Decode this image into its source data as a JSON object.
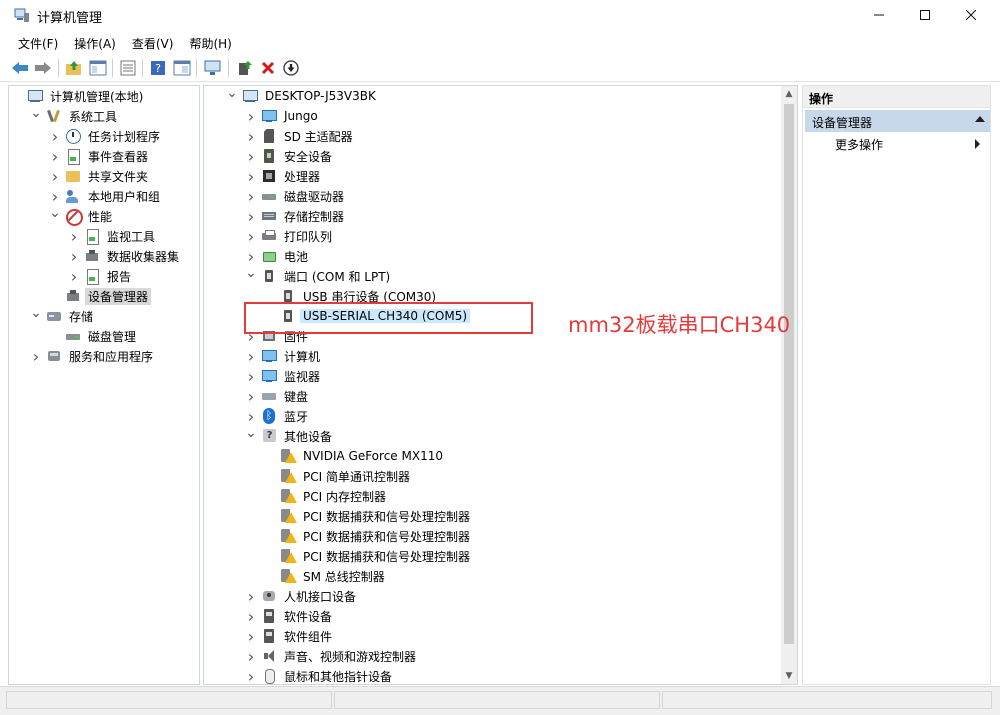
{
  "window": {
    "title": "计算机管理"
  },
  "menu": [
    "文件(F)",
    "操作(A)",
    "查看(V)",
    "帮助(H)"
  ],
  "left_tree": [
    {
      "label": "计算机管理(本地)",
      "level": 0,
      "exp": "",
      "icon": "i-pc",
      "name": "computer-management-local"
    },
    {
      "label": "系统工具",
      "level": 1,
      "exp": "v",
      "icon": "i-tools",
      "name": "system-tools"
    },
    {
      "label": "任务计划程序",
      "level": 2,
      "exp": ">",
      "icon": "i-clock",
      "name": "task-scheduler"
    },
    {
      "label": "事件查看器",
      "level": 2,
      "exp": ">",
      "icon": "i-report",
      "name": "event-viewer"
    },
    {
      "label": "共享文件夹",
      "level": 2,
      "exp": ">",
      "icon": "i-folder",
      "name": "shared-folders"
    },
    {
      "label": "本地用户和组",
      "level": 2,
      "exp": ">",
      "icon": "i-users",
      "name": "local-users-groups"
    },
    {
      "label": "性能",
      "level": 2,
      "exp": "v",
      "icon": "i-no",
      "name": "performance"
    },
    {
      "label": "监视工具",
      "level": 3,
      "exp": ">",
      "icon": "i-report",
      "name": "monitoring-tools"
    },
    {
      "label": "数据收集器集",
      "level": 3,
      "exp": ">",
      "icon": "i-devmgr",
      "name": "data-collector-sets"
    },
    {
      "label": "报告",
      "level": 3,
      "exp": ">",
      "icon": "i-report",
      "name": "reports"
    },
    {
      "label": "设备管理器",
      "level": 2,
      "exp": "",
      "icon": "i-devmgr",
      "name": "device-manager",
      "selected": true
    },
    {
      "label": "存储",
      "level": 1,
      "exp": "v",
      "icon": "i-storage",
      "name": "storage"
    },
    {
      "label": "磁盘管理",
      "level": 2,
      "exp": "",
      "icon": "i-diskdrv",
      "name": "disk-management"
    },
    {
      "label": "服务和应用程序",
      "level": 1,
      "exp": ">",
      "icon": "i-gen",
      "name": "services-applications"
    }
  ],
  "device_tree": [
    {
      "label": "DESKTOP-J53V3BK",
      "level": 0,
      "exp": "v",
      "icon": "i-pc",
      "name": "device-root"
    },
    {
      "label": "Jungo",
      "level": 1,
      "exp": ">",
      "icon": "i-monitor",
      "name": "jungo"
    },
    {
      "label": "SD 主适配器",
      "level": 1,
      "exp": ">",
      "icon": "i-sd",
      "name": "sd-host-adapters"
    },
    {
      "label": "安全设备",
      "level": 1,
      "exp": ">",
      "icon": "i-security",
      "name": "security-devices"
    },
    {
      "label": "处理器",
      "level": 1,
      "exp": ">",
      "icon": "i-proc",
      "name": "processors"
    },
    {
      "label": "磁盘驱动器",
      "level": 1,
      "exp": ">",
      "icon": "i-diskdrv",
      "name": "disk-drives"
    },
    {
      "label": "存储控制器",
      "level": 1,
      "exp": ">",
      "icon": "i-storectl",
      "name": "storage-controllers"
    },
    {
      "label": "打印队列",
      "level": 1,
      "exp": ">",
      "icon": "i-printer",
      "name": "print-queues"
    },
    {
      "label": "电池",
      "level": 1,
      "exp": ">",
      "icon": "i-battery",
      "name": "batteries"
    },
    {
      "label": "端口 (COM 和 LPT)",
      "level": 1,
      "exp": "v",
      "icon": "i-port",
      "name": "ports-com-lpt"
    },
    {
      "label": "USB 串行设备 (COM30)",
      "level": 2,
      "exp": "",
      "icon": "i-port",
      "name": "usb-serial-com30"
    },
    {
      "label": "USB-SERIAL CH340 (COM5)",
      "level": 2,
      "exp": "",
      "icon": "i-port",
      "name": "usb-serial-ch340-com5",
      "selected": true
    },
    {
      "label": "固件",
      "level": 1,
      "exp": ">",
      "icon": "i-firmware",
      "name": "firmware"
    },
    {
      "label": "计算机",
      "level": 1,
      "exp": ">",
      "icon": "i-monitor",
      "name": "computer"
    },
    {
      "label": "监视器",
      "level": 1,
      "exp": ">",
      "icon": "i-monitor",
      "name": "monitors"
    },
    {
      "label": "键盘",
      "level": 1,
      "exp": ">",
      "icon": "i-keyboard",
      "name": "keyboards"
    },
    {
      "label": "蓝牙",
      "level": 1,
      "exp": ">",
      "icon": "i-bt",
      "name": "bluetooth"
    },
    {
      "label": "其他设备",
      "level": 1,
      "exp": "v",
      "icon": "i-qmark",
      "name": "other-devices"
    },
    {
      "label": "NVIDIA GeForce MX110",
      "level": 2,
      "exp": "",
      "icon": "i-warn",
      "name": "nvidia-geforce-mx110"
    },
    {
      "label": "PCI 简单通讯控制器",
      "level": 2,
      "exp": "",
      "icon": "i-warn",
      "name": "pci-simple-comm-controller"
    },
    {
      "label": "PCI 内存控制器",
      "level": 2,
      "exp": "",
      "icon": "i-warn",
      "name": "pci-memory-controller"
    },
    {
      "label": "PCI 数据捕获和信号处理控制器",
      "level": 2,
      "exp": "",
      "icon": "i-warn",
      "name": "pci-data-acq-controller-1"
    },
    {
      "label": "PCI 数据捕获和信号处理控制器",
      "level": 2,
      "exp": "",
      "icon": "i-warn",
      "name": "pci-data-acq-controller-2"
    },
    {
      "label": "PCI 数据捕获和信号处理控制器",
      "level": 2,
      "exp": "",
      "icon": "i-warn",
      "name": "pci-data-acq-controller-3"
    },
    {
      "label": "SM 总线控制器",
      "level": 2,
      "exp": "",
      "icon": "i-warn",
      "name": "sm-bus-controller"
    },
    {
      "label": "人机接口设备",
      "level": 1,
      "exp": ">",
      "icon": "i-hid",
      "name": "human-interface-devices"
    },
    {
      "label": "软件设备",
      "level": 1,
      "exp": ">",
      "icon": "i-swdev",
      "name": "software-devices"
    },
    {
      "label": "软件组件",
      "level": 1,
      "exp": ">",
      "icon": "i-swdev",
      "name": "software-components"
    },
    {
      "label": "声音、视频和游戏控制器",
      "level": 1,
      "exp": ">",
      "icon": "i-audio",
      "name": "sound-video-game-controllers"
    },
    {
      "label": "鼠标和其他指针设备",
      "level": 1,
      "exp": ">",
      "icon": "i-mouse",
      "name": "mice-pointing-devices"
    }
  ],
  "actions": {
    "title": "操作",
    "section": "设备管理器",
    "more": "更多操作"
  },
  "annotation": {
    "text": "mm32板载串口CH340",
    "color": "#e53a3a"
  },
  "colors": {
    "selection_mid": "#cce8ff",
    "selection_left": "#d9d9d9",
    "action_section": "#c6d8ea"
  }
}
